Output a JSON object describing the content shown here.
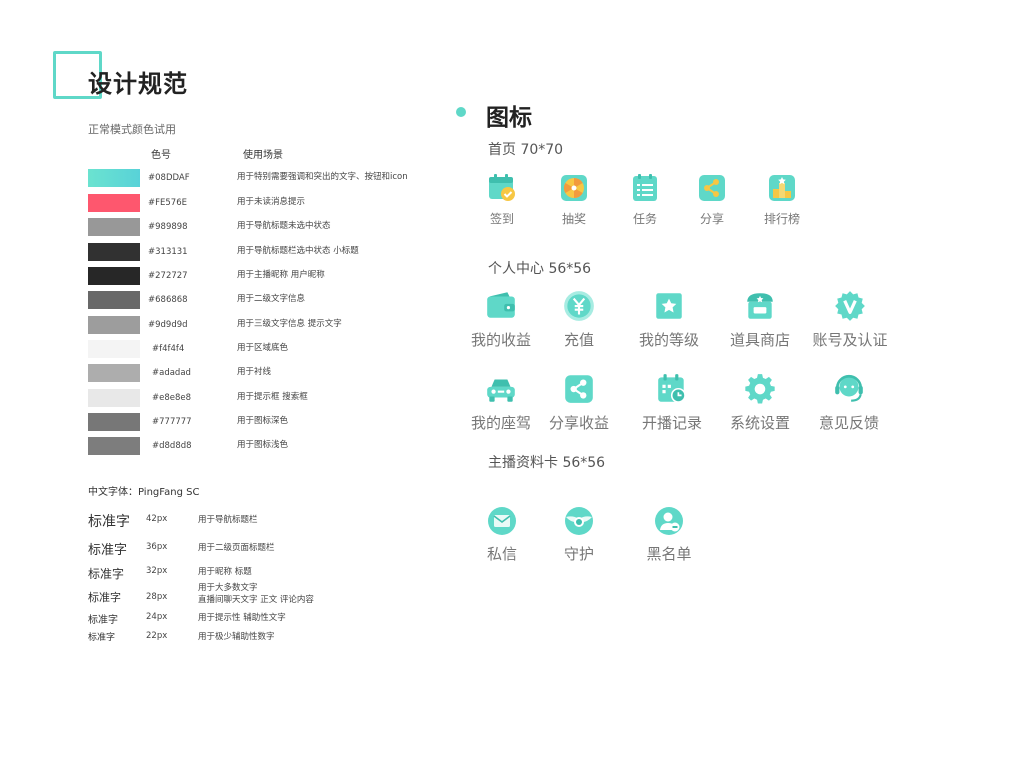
{
  "spec": {
    "title": "设计规范",
    "color_section_title": "正常模式颜色试用",
    "col_code": "色号",
    "col_usage": "使用场景",
    "colors": [
      {
        "hex": "#5fdccf",
        "code": "#08DDAF",
        "usage": "用于特别需要强调和突出的文字、按钮和icon"
      },
      {
        "hex": "#fe576e",
        "code": "#FE576E",
        "usage": "用于未读消息提示"
      },
      {
        "hex": "#989898",
        "code": "#989898",
        "usage": "用于导航标题未选中状态"
      },
      {
        "hex": "#313131",
        "code": "#313131",
        "usage": "用于导航标题栏选中状态  小标题"
      },
      {
        "hex": "#272727",
        "code": "#272727",
        "usage": "用于主播昵称 用户昵称"
      },
      {
        "hex": "#686868",
        "code": "#686868",
        "usage": "用于二级文字信息"
      },
      {
        "hex": "#9d9d9d",
        "code": "#9d9d9d",
        "usage": "用于三级文字信息 提示文字"
      },
      {
        "hex": "#f4f4f4",
        "code": "#f4f4f4",
        "usage": "用于区域底色"
      },
      {
        "hex": "#adadad",
        "code": "#adadad",
        "usage": "用于衬线"
      },
      {
        "hex": "#e8e8e8",
        "code": "#e8e8e8",
        "usage": "用于提示框 搜索框"
      },
      {
        "hex": "#777777",
        "code": "#777777",
        "usage": "用于图标深色"
      },
      {
        "hex": "#7d7d7d",
        "code": "#d8d8d8",
        "usage": "用于图标浅色"
      }
    ],
    "font_title": "中文字体：PingFang SC",
    "fonts": [
      {
        "sample": "标准字",
        "size": "42px",
        "usage": "用于导航标题栏"
      },
      {
        "sample": "标准字",
        "size": "36px",
        "usage": "用于二级页面标题栏"
      },
      {
        "sample": "标准字",
        "size": "32px",
        "usage": "用于昵称 标题"
      },
      {
        "sample": "标准字",
        "size": "28px",
        "usage": "用于大多数文字",
        "usage2": "直播间聊天文字 正文 评论内容"
      },
      {
        "sample": "标准字",
        "size": "24px",
        "usage": "用于提示性 辅助性文字"
      },
      {
        "sample": "标准字",
        "size": "22px",
        "usage": "用于极少辅助性数字"
      }
    ]
  },
  "icons": {
    "title": "图标",
    "accent": "#5fd8c8",
    "home_title": "首页  70*70",
    "home": [
      {
        "label": "签到",
        "icon": "calendar-check-icon"
      },
      {
        "label": "抽奖",
        "icon": "lottery-wheel-icon"
      },
      {
        "label": "任务",
        "icon": "task-list-icon"
      },
      {
        "label": "分享",
        "icon": "share-icon"
      },
      {
        "label": "排行榜",
        "icon": "podium-icon"
      }
    ],
    "personal_title": "个人中心  56*56",
    "personal_row1": [
      {
        "label": "我的收益",
        "icon": "wallet-icon"
      },
      {
        "label": "充值",
        "icon": "yen-coin-icon"
      },
      {
        "label": "我的等级",
        "icon": "star-badge-icon"
      },
      {
        "label": "道具商店",
        "icon": "shop-icon"
      },
      {
        "label": "账号及认证",
        "icon": "verified-v-icon"
      }
    ],
    "personal_row2": [
      {
        "label": "我的座驾",
        "icon": "car-icon"
      },
      {
        "label": "分享收益",
        "icon": "share-earnings-icon"
      },
      {
        "label": "开播记录",
        "icon": "broadcast-calendar-icon"
      },
      {
        "label": "系统设置",
        "icon": "gear-icon"
      },
      {
        "label": "意见反馈",
        "icon": "headset-icon"
      }
    ],
    "host_title": "主播资料卡  56*56",
    "host": [
      {
        "label": "私信",
        "icon": "envelope-icon"
      },
      {
        "label": "守护",
        "icon": "guard-wings-icon"
      },
      {
        "label": "黑名单",
        "icon": "blacklist-user-icon"
      }
    ]
  }
}
